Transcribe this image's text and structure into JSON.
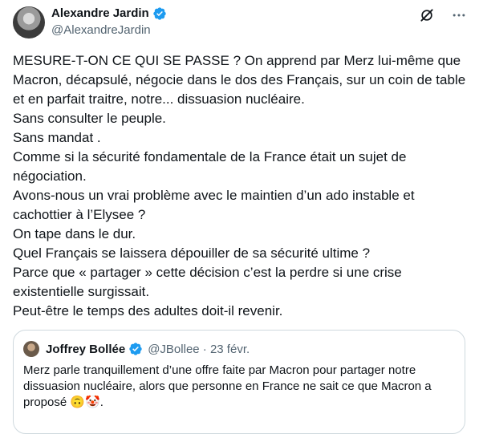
{
  "tweet": {
    "author_name": "Alexandre Jardin",
    "author_handle": "@AlexandreJardin",
    "text": "MESURE-T-ON CE QUI SE PASSE ? On apprend par Merz lui-même que Macron, décapsulé, négocie dans le dos des Français, sur un coin de table et en parfait traitre, notre... dissuasion nucléaire.\nSans consulter le peuple.\nSans mandat .\nComme si la sécurité fondamentale de la France était un sujet de négociation.\nAvons-nous un vrai problème avec le maintien d’un ado instable et cachottier à l’Elysee ?\nOn tape dans le dur.\nQuel Français se laissera dépouiller de sa sécurité ultime ?\nParce que « partager » cette décision c’est la perdre si une crise existentielle surgissait.\nPeut-être le temps des adultes doit-il revenir."
  },
  "quoted_tweet": {
    "author_name": "Joffrey Bollée",
    "author_handle": "@JBollee · 23 févr.",
    "text": "Merz parle tranquillement d’une offre faite par Macron pour partager notre dissuasion nucléaire, alors que personne en France ne sait ce que Macron a proposé 🙃🤡."
  },
  "icons": {
    "verified": "verified-badge-icon",
    "grok": "grok-icon",
    "more": "more-options-icon"
  },
  "colors": {
    "verified_blue": "#1d9bf0",
    "text": "#0f1419",
    "secondary": "#536471",
    "border": "#cfd9de"
  }
}
